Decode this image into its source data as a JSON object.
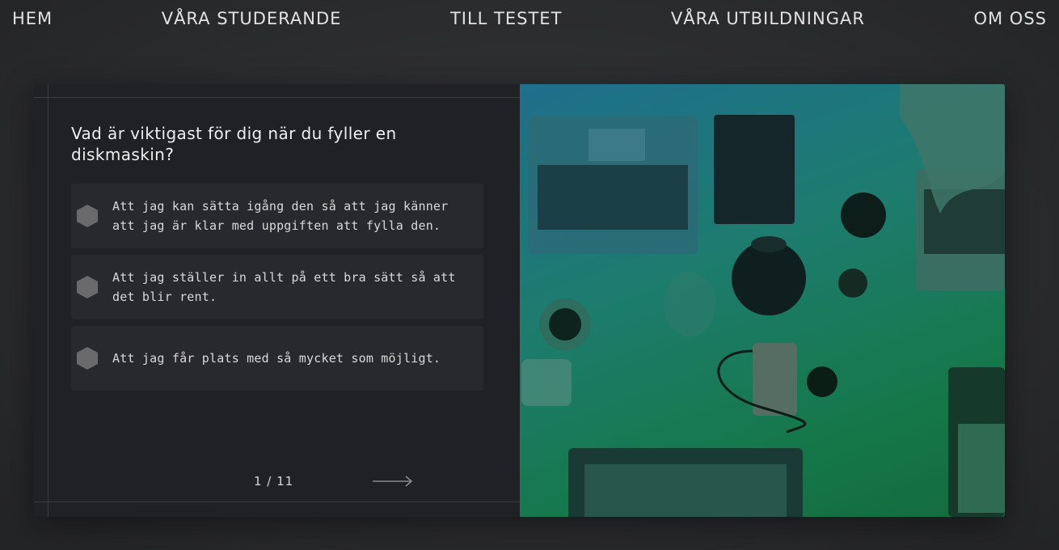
{
  "nav": {
    "items": [
      "HEM",
      "VÅRA STUDERANDE",
      "TILL TESTET",
      "VÅRA UTBILDNINGAR",
      "OM OSS"
    ]
  },
  "quiz": {
    "question": "Vad är viktigast för dig när du fyller en diskmaskin?",
    "options": [
      "Att jag kan sätta igång den så att jag känner att jag är klar med uppgiften att fylla den.",
      "Att jag ställer in allt på ett bra sätt så att det blir rent.",
      "Att jag får plats med så mycket som möjligt."
    ],
    "pager": "1 / 11"
  },
  "colors": {
    "panel": "#1f2124",
    "option_bg": "#28292d",
    "hex_icon": "#6a6a6c",
    "image_tint_top": "#1e6f8c",
    "image_tint_bottom": "#146b3c"
  },
  "icons": {
    "option": "hexagon-icon",
    "next": "arrow-right-icon"
  }
}
